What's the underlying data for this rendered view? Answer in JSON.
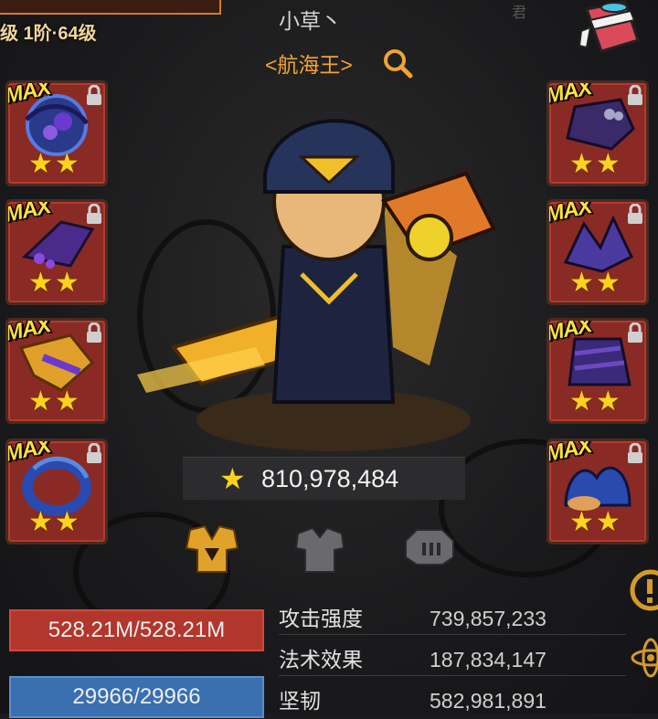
{
  "header": {
    "level_text": "级 1阶·64级",
    "player_name": "小草丶",
    "guild_name": "<航海王>",
    "faded_text": "君"
  },
  "equipment_left": [
    {
      "badge": "MAX",
      "stars": 2,
      "art": "blue-orb-cloak"
    },
    {
      "badge": "MAX",
      "stars": 2,
      "art": "purple-gauntlet"
    },
    {
      "badge": "MAX",
      "stars": 2,
      "art": "golden-blade"
    },
    {
      "badge": "MAX",
      "stars": 2,
      "art": "blue-ring"
    }
  ],
  "equipment_right": [
    {
      "badge": "MAX",
      "stars": 2,
      "art": "purple-helm"
    },
    {
      "badge": "MAX",
      "stars": 2,
      "art": "purple-claws"
    },
    {
      "badge": "MAX",
      "stars": 2,
      "art": "purple-armor"
    },
    {
      "badge": "MAX",
      "stars": 2,
      "art": "blue-flame-boots"
    }
  ],
  "stars_glyph": "★★",
  "power": {
    "icon": "star-icon",
    "value": "810,978,484"
  },
  "tabs": [
    {
      "name": "gold-armor-tab",
      "active": true
    },
    {
      "name": "grey-armor-tab",
      "active": false
    },
    {
      "name": "grey-mech-tab",
      "active": false
    }
  ],
  "bars": {
    "hp": "528.21M/528.21M",
    "mp": "29966/29966"
  },
  "attributes": [
    {
      "name": "攻击强度",
      "value": "739,857,233"
    },
    {
      "name": "法术效果",
      "value": "187,834,147"
    },
    {
      "name": "坚韧",
      "value": "582,981,891"
    }
  ],
  "colors": {
    "slot_bg": "#8a2a24",
    "star": "#ffd21e",
    "guild": "#f1a334",
    "hp": "#b2362b",
    "mp": "#3a6fb0"
  }
}
